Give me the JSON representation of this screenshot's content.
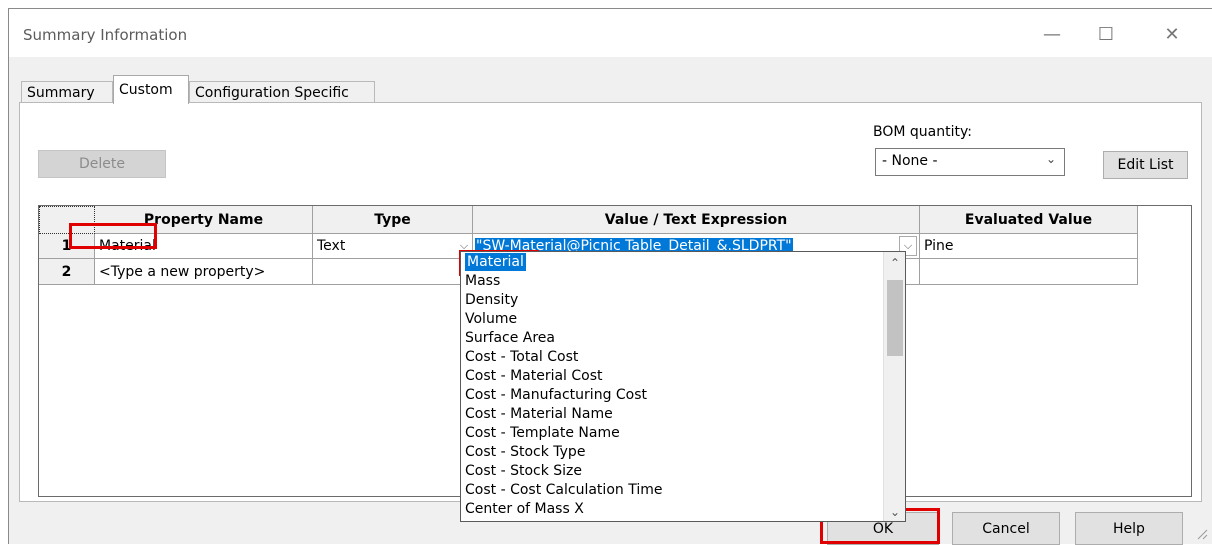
{
  "window": {
    "title": "Summary Information"
  },
  "tabs": [
    {
      "label": "Summary"
    },
    {
      "label": "Custom"
    },
    {
      "label": "Configuration Specific"
    }
  ],
  "toolbar": {
    "delete_label": "Delete",
    "bom_label": "BOM quantity:",
    "bom_value": "- None -",
    "edit_list_label": "Edit List"
  },
  "table": {
    "headers": [
      "Property Name",
      "Type",
      "Value / Text Expression",
      "Evaluated Value"
    ],
    "rows": [
      {
        "num": "1",
        "name": "Material",
        "type": "Text",
        "value": "\"SW-Material@Picnic Table_Detail_&.SLDPRT\"",
        "evaluated": "Pine"
      },
      {
        "num": "2",
        "name": "<Type a new property>",
        "type": "",
        "value": "",
        "evaluated": ""
      }
    ]
  },
  "dropdown": {
    "items": [
      "Material",
      "Mass",
      "Density",
      "Volume",
      "Surface Area",
      "Cost - Total Cost",
      "Cost - Material Cost",
      "Cost - Manufacturing Cost",
      "Cost - Material Name",
      "Cost - Template Name",
      "Cost - Stock Type",
      "Cost - Stock Size",
      "Cost - Cost Calculation Time",
      "Center of Mass X"
    ]
  },
  "footer": {
    "ok_label": "OK",
    "cancel_label": "Cancel",
    "help_label": "Help"
  },
  "colors": {
    "highlight": "#0078d7",
    "annotation": "#e00000"
  }
}
